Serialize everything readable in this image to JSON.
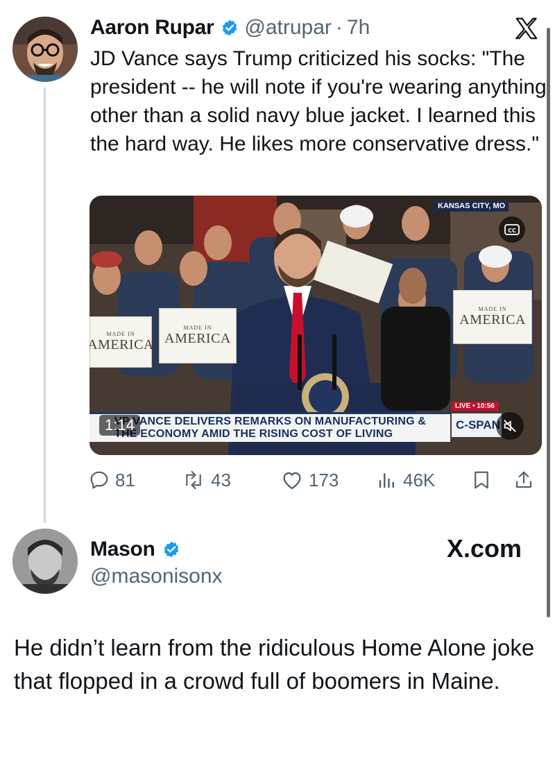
{
  "tweet": {
    "author": {
      "name": "Aaron Rupar",
      "handle": "@atrupar",
      "separator": "·",
      "time": "7h",
      "verified_icon": "verified-badge-icon",
      "avatar_icon": "avatar-photo"
    },
    "platform_icon": "x-logo-icon",
    "text": "JD Vance says Trump criticized his socks: \"The president -- he will note if you're wearing anything other than a solid navy blue jacket. I learned this the hard way. He likes more conservative dress.\"",
    "video": {
      "duration": "1:14",
      "location_badge": "KANSAS CITY, MO",
      "live_badge": "LIVE • 10:56",
      "lower_third_line1": "VP VANCE DELIVERS REMARKS ON MANUFACTURING &",
      "lower_third_line2": "THE ECONOMY AMID THE RISING COST OF LIVING",
      "network_logo": "C-SPAN",
      "sign_text_small": "MADE IN",
      "sign_text_big": "AMERICA",
      "cc_icon": "closed-captions-icon",
      "mute_icon": "muted-speaker-icon"
    },
    "actions": {
      "replies": "81",
      "reposts": "43",
      "likes": "173",
      "views": "46K",
      "bookmark_icon": "bookmark-icon",
      "share_icon": "share-icon"
    }
  },
  "reply": {
    "author": {
      "name": "Mason",
      "handle": "@masonisonx",
      "verified_icon": "verified-badge-icon",
      "avatar_icon": "avatar-photo"
    },
    "watermark": "X.com",
    "text": "He didn’t learn from the ridiculous Home Alone joke that flopped in a crowd full of boomers in Maine."
  },
  "colors": {
    "text": "#0f1419",
    "secondary_text": "#536471",
    "verified_blue": "#1d9bf0",
    "thread_line": "#cfd9de",
    "tie_red": "#c8102e",
    "chyron_navy": "#17305c"
  }
}
